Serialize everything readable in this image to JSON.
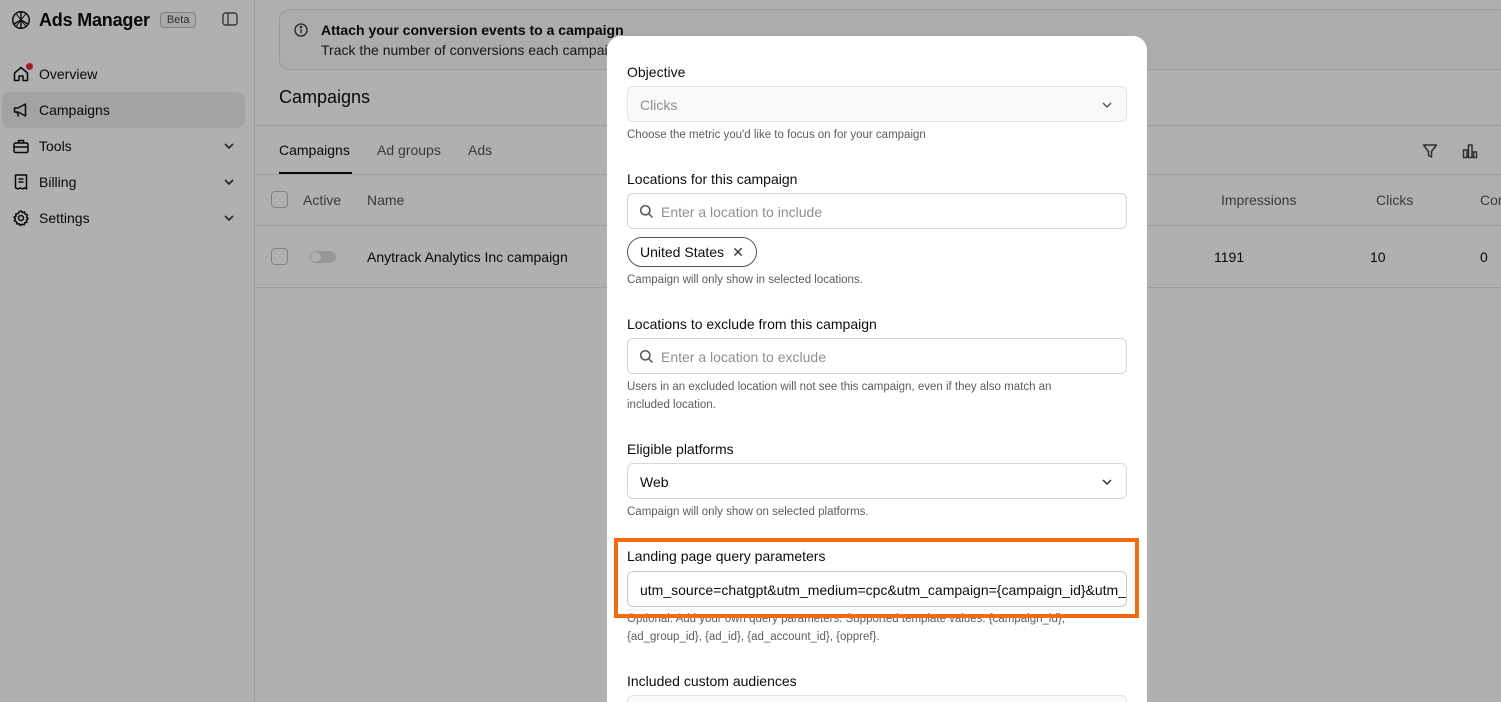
{
  "app": {
    "name": "Ads Manager",
    "badge": "Beta"
  },
  "sidebar": {
    "items": [
      {
        "label": "Overview",
        "icon": "home-icon",
        "active": false,
        "notification": true
      },
      {
        "label": "Campaigns",
        "icon": "megaphone-icon",
        "active": true
      },
      {
        "label": "Tools",
        "icon": "toolbox-icon",
        "expandable": true
      },
      {
        "label": "Billing",
        "icon": "receipt-icon",
        "expandable": true
      },
      {
        "label": "Settings",
        "icon": "gear-icon",
        "expandable": true
      }
    ]
  },
  "banner": {
    "title": "Attach your conversion events to a campaign",
    "text": "Track the number of conversions each campai"
  },
  "page": {
    "title": "Campaigns"
  },
  "tabs": [
    {
      "label": "Campaigns",
      "active": true
    },
    {
      "label": "Ad groups"
    },
    {
      "label": "Ads"
    }
  ],
  "table": {
    "headers": {
      "active": "Active",
      "name": "Name",
      "impressions": "Impressions",
      "clicks": "Clicks",
      "conversions": "Cor"
    },
    "rows": [
      {
        "name": "Anytrack Analytics Inc campaign",
        "impressions": "1191",
        "clicks": "10",
        "conversions": "0"
      }
    ]
  },
  "modal": {
    "objective": {
      "label": "Objective",
      "value": "Clicks",
      "help": "Choose the metric you'd like to focus on for your campaign"
    },
    "locations_include": {
      "label": "Locations for this campaign",
      "placeholder": "Enter a location to include",
      "chip": "United States",
      "help": "Campaign will only show in selected locations."
    },
    "locations_exclude": {
      "label": "Locations to exclude from this campaign",
      "placeholder": "Enter a location to exclude",
      "help": "Users in an excluded location will not see this campaign, even if they also match an included location."
    },
    "platforms": {
      "label": "Eligible platforms",
      "value": "Web",
      "help": "Campaign will only show on selected platforms."
    },
    "query_params": {
      "label": "Landing page query parameters",
      "value": "utm_source=chatgpt&utm_medium=cpc&utm_campaign={campaign_id}&utm_content={ad_id}",
      "help": "Optional. Add your own query parameters. Supported template values: {campaign_id}, {ad_group_id}, {ad_id}, {ad_account_id}, {oppref}."
    },
    "custom_audiences": {
      "label": "Included custom audiences"
    }
  },
  "colors": {
    "highlight": "#f26b0f",
    "notification": "#e0332e"
  }
}
